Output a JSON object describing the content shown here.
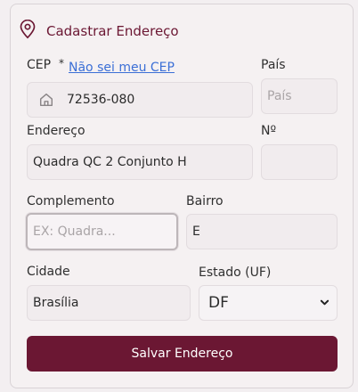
{
  "form": {
    "title": "Cadastrar Endereço",
    "cep": {
      "label": "CEP",
      "required_mark": "*",
      "link": "Não sei meu CEP",
      "value": "72536-080"
    },
    "pais": {
      "label": "País",
      "placeholder": "País",
      "value": ""
    },
    "endereco": {
      "label": "Endereço",
      "value": "Quadra QC 2 Conjunto H"
    },
    "numero": {
      "label": "Nº",
      "value": ""
    },
    "complemento": {
      "label": "Complemento",
      "placeholder": "EX: Quadra...",
      "value": ""
    },
    "bairro": {
      "label": "Bairro",
      "value": "E"
    },
    "cidade": {
      "label": "Cidade",
      "value": "Brasília"
    },
    "estado": {
      "label": "Estado (UF)",
      "selected": "DF"
    },
    "submit_label": "Salvar Endereço"
  },
  "colors": {
    "accent": "#6b1733",
    "link": "#3b6fd6"
  },
  "icons": {
    "title": "location-pin-icon",
    "cep": "home-icon",
    "select": "chevron-down-icon"
  }
}
